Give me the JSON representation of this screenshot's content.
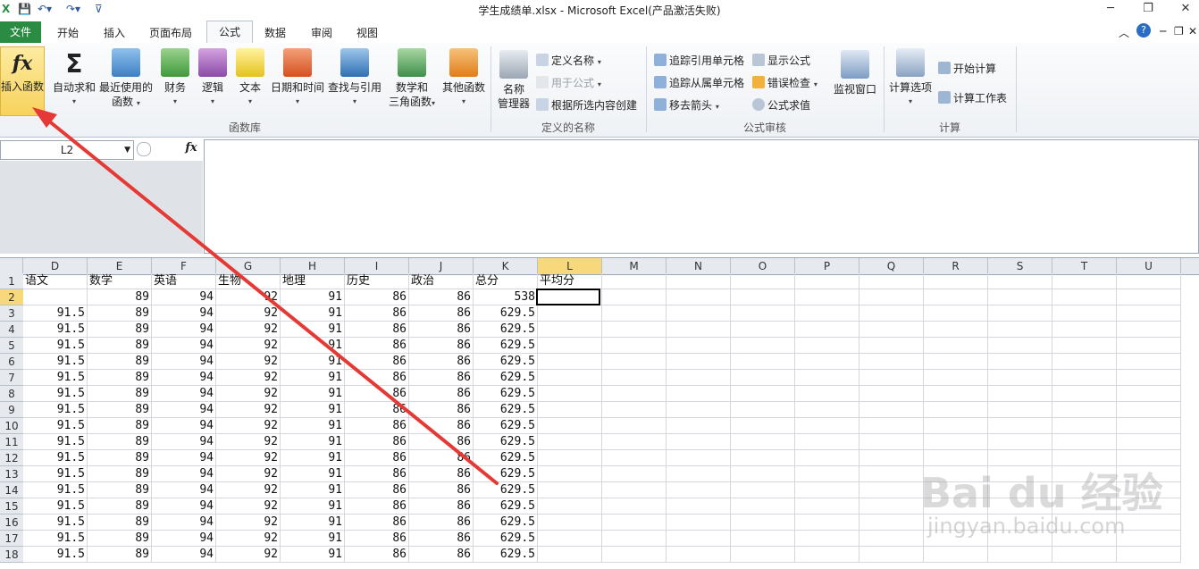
{
  "titlebar": {
    "title": "学生成绩单.xlsx  -  Microsoft Excel(产品激活失败)",
    "window_buttons": [
      "─",
      "❐",
      "✕"
    ]
  },
  "tabs": {
    "file": "文件",
    "items": [
      "开始",
      "插入",
      "页面布局",
      "公式",
      "数据",
      "审阅",
      "视图"
    ]
  },
  "ribbon": {
    "function_library": {
      "insert_function": "插入函数",
      "autosum": "自动求和",
      "recent_line1": "最近使用的",
      "recent_line2": "函数",
      "financial": "财务",
      "logical": "逻辑",
      "text": "文本",
      "datetime": "日期和时间",
      "lookup": "查找与引用",
      "math_line1": "数学和",
      "math_line2": "三角函数",
      "more": "其他函数",
      "group_label": "函数库"
    },
    "defined_names": {
      "name_manager_line1": "名称",
      "name_manager_line2": "管理器",
      "define_name": "定义名称",
      "use_in_formula": "用于公式",
      "create_from_selection": "根据所选内容创建",
      "group_label": "定义的名称"
    },
    "formula_auditing": {
      "trace_precedents": "追踪引用单元格",
      "trace_dependents": "追踪从属单元格",
      "remove_arrows": "移去箭头",
      "show_formulas": "显示公式",
      "error_checking": "错误检查",
      "evaluate_formula": "公式求值",
      "watch_window": "监视窗口",
      "group_label": "公式审核"
    },
    "calculation": {
      "calc_options": "计算选项",
      "calc_now": "开始计算",
      "calc_sheet": "计算工作表",
      "group_label": "计算"
    }
  },
  "formula_bar": {
    "name_box": "L2",
    "fx": "fx",
    "value": ""
  },
  "grid": {
    "columns": [
      "D",
      "E",
      "F",
      "G",
      "H",
      "I",
      "J",
      "K",
      "L",
      "M",
      "N",
      "O",
      "P",
      "Q",
      "R",
      "S",
      "T",
      "U"
    ],
    "headers": [
      "语文",
      "数学",
      "英语",
      "生物",
      "地理",
      "历史",
      "政治",
      "总分",
      "平均分"
    ],
    "rows": [
      {
        "n": "1"
      },
      {
        "n": "2",
        "v": [
          "",
          "89",
          "94",
          "92",
          "91",
          "86",
          "86",
          "538"
        ]
      },
      {
        "n": "3",
        "v": [
          "91.5",
          "89",
          "94",
          "92",
          "91",
          "86",
          "86",
          "629.5"
        ]
      },
      {
        "n": "4",
        "v": [
          "91.5",
          "89",
          "94",
          "92",
          "91",
          "86",
          "86",
          "629.5"
        ]
      },
      {
        "n": "5",
        "v": [
          "91.5",
          "89",
          "94",
          "92",
          "91",
          "86",
          "86",
          "629.5"
        ]
      },
      {
        "n": "6",
        "v": [
          "91.5",
          "89",
          "94",
          "92",
          "91",
          "86",
          "86",
          "629.5"
        ]
      },
      {
        "n": "7",
        "v": [
          "91.5",
          "89",
          "94",
          "92",
          "91",
          "86",
          "86",
          "629.5"
        ]
      },
      {
        "n": "8",
        "v": [
          "91.5",
          "89",
          "94",
          "92",
          "91",
          "86",
          "86",
          "629.5"
        ]
      },
      {
        "n": "9",
        "v": [
          "91.5",
          "89",
          "94",
          "92",
          "91",
          "86",
          "86",
          "629.5"
        ]
      },
      {
        "n": "10",
        "v": [
          "91.5",
          "89",
          "94",
          "92",
          "91",
          "86",
          "86",
          "629.5"
        ]
      },
      {
        "n": "11",
        "v": [
          "91.5",
          "89",
          "94",
          "92",
          "91",
          "86",
          "86",
          "629.5"
        ]
      },
      {
        "n": "12",
        "v": [
          "91.5",
          "89",
          "94",
          "92",
          "91",
          "86",
          "86",
          "629.5"
        ]
      },
      {
        "n": "13",
        "v": [
          "91.5",
          "89",
          "94",
          "92",
          "91",
          "86",
          "86",
          "629.5"
        ]
      },
      {
        "n": "14",
        "v": [
          "91.5",
          "89",
          "94",
          "92",
          "91",
          "86",
          "86",
          "629.5"
        ]
      },
      {
        "n": "15",
        "v": [
          "91.5",
          "89",
          "94",
          "92",
          "91",
          "86",
          "86",
          "629.5"
        ]
      },
      {
        "n": "16",
        "v": [
          "91.5",
          "89",
          "94",
          "92",
          "91",
          "86",
          "86",
          "629.5"
        ]
      },
      {
        "n": "17",
        "v": [
          "91.5",
          "89",
          "94",
          "92",
          "91",
          "86",
          "86",
          "629.5"
        ]
      },
      {
        "n": "18",
        "v": [
          "91.5",
          "89",
          "94",
          "92",
          "91",
          "86",
          "86",
          "629.5"
        ]
      }
    ]
  },
  "watermark": {
    "brand": "Bai du 经验",
    "url": "jingyan.baidu.com"
  },
  "colors": {
    "file_tab": "#2a8c43",
    "annotation_arrow": "#e53935",
    "selection": "#000000"
  }
}
